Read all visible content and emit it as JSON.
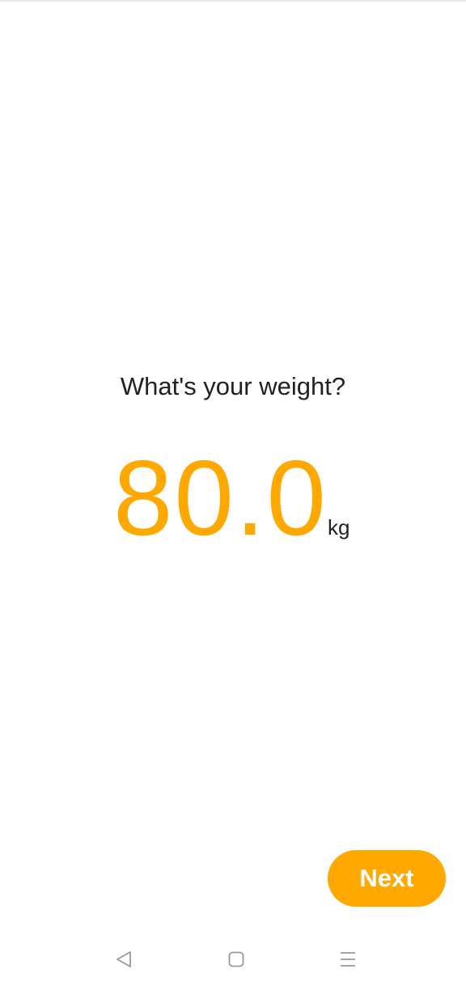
{
  "question": "What's your weight?",
  "weight": {
    "value": "80.0",
    "unit": "kg"
  },
  "next_button": {
    "label": "Next"
  },
  "navigation": {
    "back_icon": "back-triangle-icon",
    "home_icon": "home-square-icon",
    "menu_icon": "menu-lines-icon"
  },
  "colors": {
    "accent": "#ffa800",
    "text": "#222222",
    "nav_icon": "#9a9a9a",
    "background": "#ffffff"
  }
}
